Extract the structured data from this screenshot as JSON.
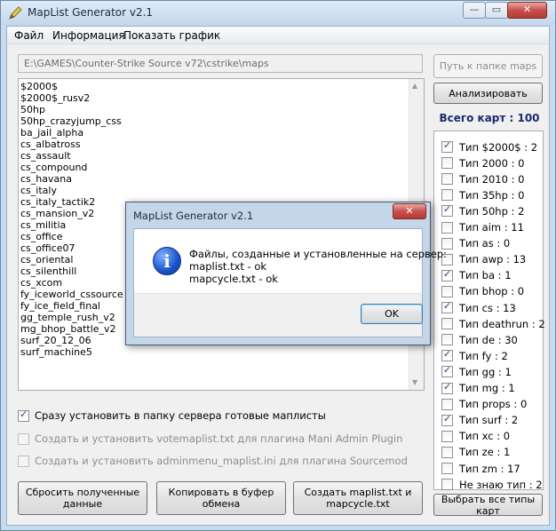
{
  "window": {
    "title": "MapList Generator v2.1",
    "min_glyph": "—",
    "max_glyph": "▭",
    "close_glyph": "✕"
  },
  "menu": [
    "Файл",
    "Информация",
    "Показать график"
  ],
  "path": {
    "value": "E:\\GAMES\\Counter-Strike Source v72\\cstrike\\maps"
  },
  "buttons": {
    "browse": "Путь к папке maps",
    "analyze": "Анализировать",
    "reset": "Сбросить полученные данные",
    "copy": "Копировать в буфер обмена",
    "create": "Создать maplist.txt и mapcycle.txt",
    "select_all": "Выбрать все типы карт"
  },
  "maps": [
    "$2000$",
    "$2000$_rusv2",
    "50hp",
    "50hp_crazyjump_css",
    "ba_jail_alpha",
    "cs_albatross",
    "cs_assault",
    "cs_compound",
    "cs_havana",
    "cs_italy",
    "cs_italy_tactik2",
    "cs_mansion_v2",
    "cs_militia",
    "cs_office",
    "cs_office07",
    "cs_oriental",
    "cs_silenthill",
    "cs_xcom",
    "fy_iceworld_cssource",
    "fy_ice_field_final",
    "gg_temple_rush_v2",
    "mg_bhop_battle_v2",
    "surf_20_12_06",
    "surf_machine5"
  ],
  "options": [
    {
      "label": "Сразу установить в папку сервера готовые маплисты",
      "checked": true,
      "disabled": false
    },
    {
      "label": "Создать и установить votemaplist.txt для плагина Mani Admin Plugin",
      "checked": false,
      "disabled": true
    },
    {
      "label": "Создать и установить adminmenu_maplist.ini для плагина Sourcemod",
      "checked": false,
      "disabled": true
    }
  ],
  "total": "Всего карт : 100",
  "types": [
    {
      "label": "Тип $2000$ : 2",
      "checked": true
    },
    {
      "label": "Тип 2000 : 0",
      "checked": false
    },
    {
      "label": "Тип 2010 : 0",
      "checked": false
    },
    {
      "label": "Тип 35hp : 0",
      "checked": false
    },
    {
      "label": "Тип 50hp : 2",
      "checked": true
    },
    {
      "label": "Тип aim : 11",
      "checked": false
    },
    {
      "label": "Тип as : 0",
      "checked": false
    },
    {
      "label": "Тип awp : 13",
      "checked": false
    },
    {
      "label": "Тип ba : 1",
      "checked": true
    },
    {
      "label": "Тип bhop : 0",
      "checked": false
    },
    {
      "label": "Тип cs : 13",
      "checked": true
    },
    {
      "label": "Тип deathrun : 2",
      "checked": false
    },
    {
      "label": "Тип de : 30",
      "checked": false
    },
    {
      "label": "Тип fy : 2",
      "checked": true
    },
    {
      "label": "Тип gg : 1",
      "checked": true
    },
    {
      "label": "Тип mg : 1",
      "checked": true
    },
    {
      "label": "Тип props : 0",
      "checked": false
    },
    {
      "label": "Тип surf : 2",
      "checked": true
    },
    {
      "label": "Тип xc : 0",
      "checked": false
    },
    {
      "label": "Тип ze : 1",
      "checked": false
    },
    {
      "label": "Тип zm : 17",
      "checked": false
    },
    {
      "label": "Не знаю тип : 2",
      "checked": false
    }
  ],
  "dialog": {
    "title": "MapList Generator v2.1",
    "close_glyph": "✕",
    "icon_glyph": "i",
    "lines": [
      "Файлы, созданные и установленные на сервер:",
      "maplist.txt - ok",
      "mapcycle.txt - ok"
    ],
    "ok": "OK"
  },
  "colors": {
    "accent": "#1c2a6e",
    "check": "#2b4f8c",
    "window_frame": "#c9dcef"
  }
}
